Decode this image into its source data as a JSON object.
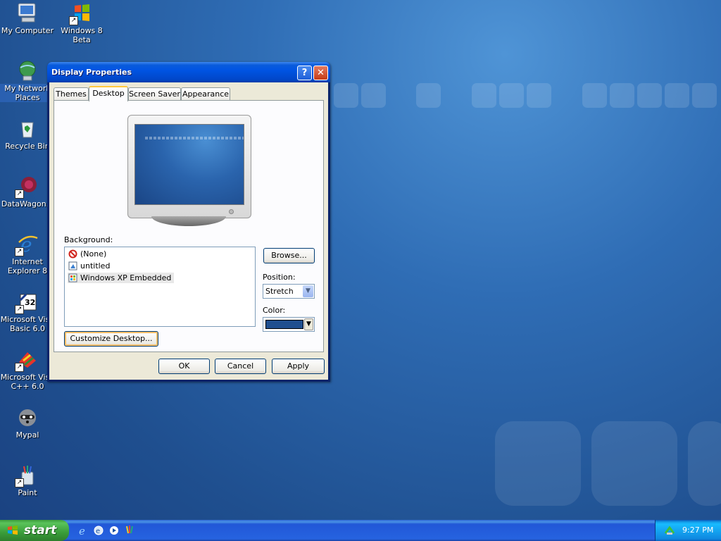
{
  "desktop": {
    "icons": [
      {
        "label": "My Computer"
      },
      {
        "label": "Windows 8\nBeta"
      },
      {
        "label": "My Network\nPlaces"
      },
      {
        "label": "Recycle Bin"
      },
      {
        "label": "DataWagon..."
      },
      {
        "label": "Internet\nExplorer 8"
      },
      {
        "label": "Microsoft Visu\nBasic 6.0"
      },
      {
        "label": "Microsoft Visu\nC++ 6.0"
      },
      {
        "label": "Mypal"
      },
      {
        "label": "Paint"
      }
    ]
  },
  "window": {
    "title": "Display Properties",
    "help_label": "?",
    "close_label": "✕",
    "tabs": [
      {
        "label": "Themes"
      },
      {
        "label": "Desktop"
      },
      {
        "label": "Screen Saver"
      },
      {
        "label": "Appearance"
      }
    ],
    "background_label": "Background:",
    "background_items": [
      {
        "label": "(None)"
      },
      {
        "label": "untitled"
      },
      {
        "label": "Windows XP Embedded"
      }
    ],
    "browse_label": "Browse...",
    "position_label": "Position:",
    "position_value": "Stretch",
    "color_label": "Color:",
    "color_value": "#1f4f8f",
    "customize_label": "Customize Desktop...",
    "ok_label": "OK",
    "cancel_label": "Cancel",
    "apply_label": "Apply"
  },
  "taskbar": {
    "start_label": "start",
    "clock": "9:27 PM"
  }
}
